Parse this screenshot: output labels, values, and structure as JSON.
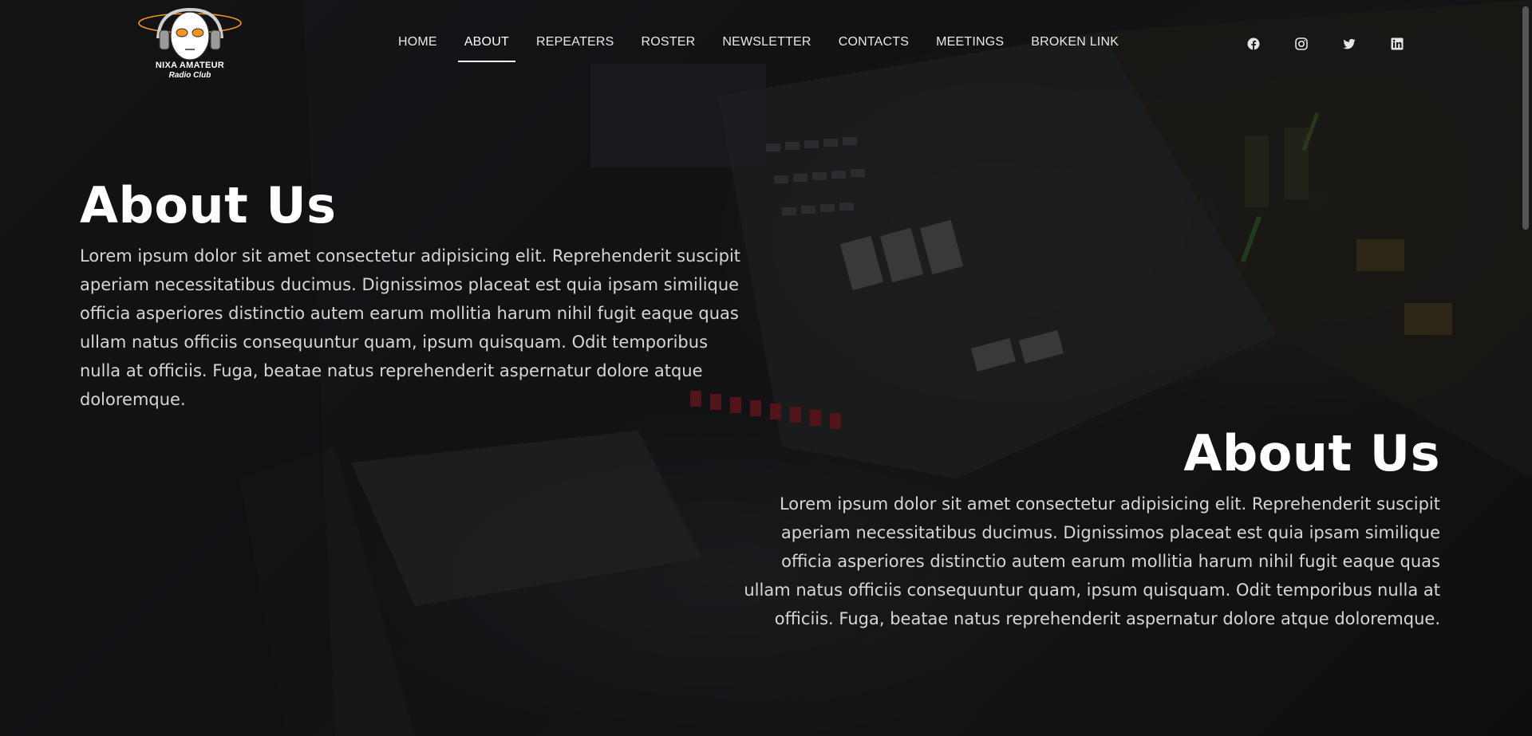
{
  "brand": {
    "name_line1": "NIXA AMATEUR",
    "name_line2": "Radio Club",
    "accent_color": "#f7941d"
  },
  "nav": {
    "items": [
      {
        "label": "HOME",
        "active": false
      },
      {
        "label": "ABOUT",
        "active": true
      },
      {
        "label": "REPEATERS",
        "active": false
      },
      {
        "label": "ROSTER",
        "active": false
      },
      {
        "label": "NEWSLETTER",
        "active": false
      },
      {
        "label": "CONTACTS",
        "active": false
      },
      {
        "label": "MEETINGS",
        "active": false
      },
      {
        "label": "BROKEN LINK",
        "active": false
      }
    ]
  },
  "social": {
    "icons": [
      "facebook-icon",
      "instagram-icon",
      "twitter-icon",
      "linkedin-icon"
    ]
  },
  "sections": [
    {
      "title": "About Us",
      "body": "Lorem ipsum dolor sit amet consectetur adipisicing elit. Reprehenderit suscipit aperiam necessitatibus ducimus. Dignissimos placeat est quia ipsam similique officia asperiores distinctio autem earum mollitia harum nihil fugit eaque quas ullam natus officiis consequuntur quam, ipsum quisquam. Odit temporibus nulla at officiis. Fuga, beatae natus reprehenderit aspernatur dolore atque doloremque."
    },
    {
      "title": "About Us",
      "body": "Lorem ipsum dolor sit amet consectetur adipisicing elit. Reprehenderit suscipit aperiam necessitatibus ducimus. Dignissimos placeat est quia ipsam similique officia asperiores distinctio autem earum mollitia harum nihil fugit eaque quas ullam natus officiis consequuntur quam, ipsum quisquam. Odit temporibus nulla at officiis. Fuga, beatae natus reprehenderit aspernatur dolore atque doloremque."
    }
  ]
}
